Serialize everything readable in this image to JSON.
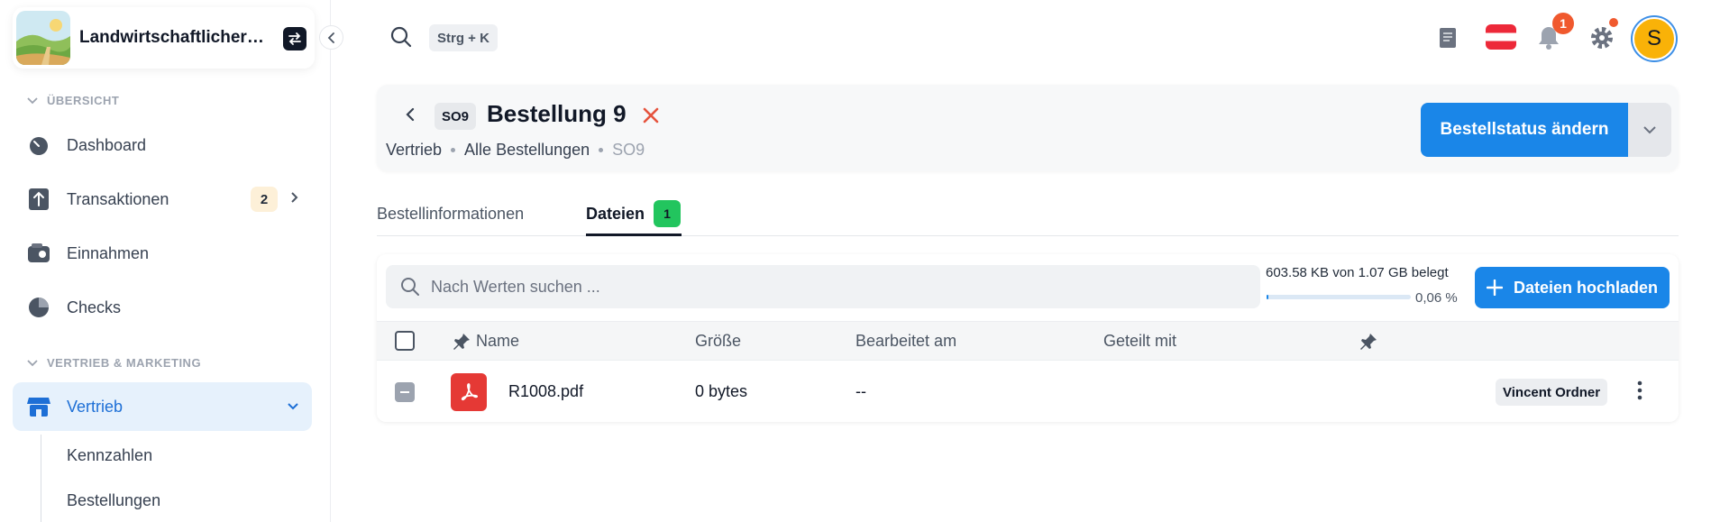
{
  "sidebar": {
    "company_name": "Landwirtschaftlicher B...",
    "sections": [
      {
        "label": "ÜBERSICHT"
      },
      {
        "label": "VERTRIEB & MARKETING"
      }
    ],
    "items": [
      {
        "label": "Dashboard"
      },
      {
        "label": "Transaktionen",
        "badge": "2"
      },
      {
        "label": "Einnahmen"
      },
      {
        "label": "Checks"
      },
      {
        "label": "Vertrieb"
      }
    ],
    "sub_items": [
      {
        "label": "Kennzahlen"
      },
      {
        "label": "Bestellungen"
      }
    ]
  },
  "topbar": {
    "shortcut": "Strg + K",
    "notification_count": "1",
    "avatar_initial": "S"
  },
  "header": {
    "tag": "SO9",
    "title": "Bestellung 9",
    "breadcrumb": [
      "Vertrieb",
      "Alle Bestellungen",
      "SO9"
    ],
    "primary_action": "Bestellstatus ändern"
  },
  "tabs": [
    {
      "label": "Bestellinformationen"
    },
    {
      "label": "Dateien",
      "badge": "1"
    }
  ],
  "files": {
    "search_placeholder": "Nach Werten suchen ...",
    "storage_text": "603.58 KB von 1.07 GB belegt",
    "storage_percent_text": "0,06 %",
    "storage_fraction": 0.0006,
    "upload_label": "Dateien hochladen",
    "columns": [
      "Name",
      "Größe",
      "Bearbeitet am",
      "Geteilt mit"
    ],
    "rows": [
      {
        "name": "R1008.pdf",
        "size": "0 bytes",
        "edited": "--",
        "shared_with": "Vincent Ordner"
      }
    ]
  },
  "colors": {
    "accent": "#1a86e8",
    "notification": "#f0592e",
    "success": "#22c55e",
    "pdf": "#e53935"
  }
}
